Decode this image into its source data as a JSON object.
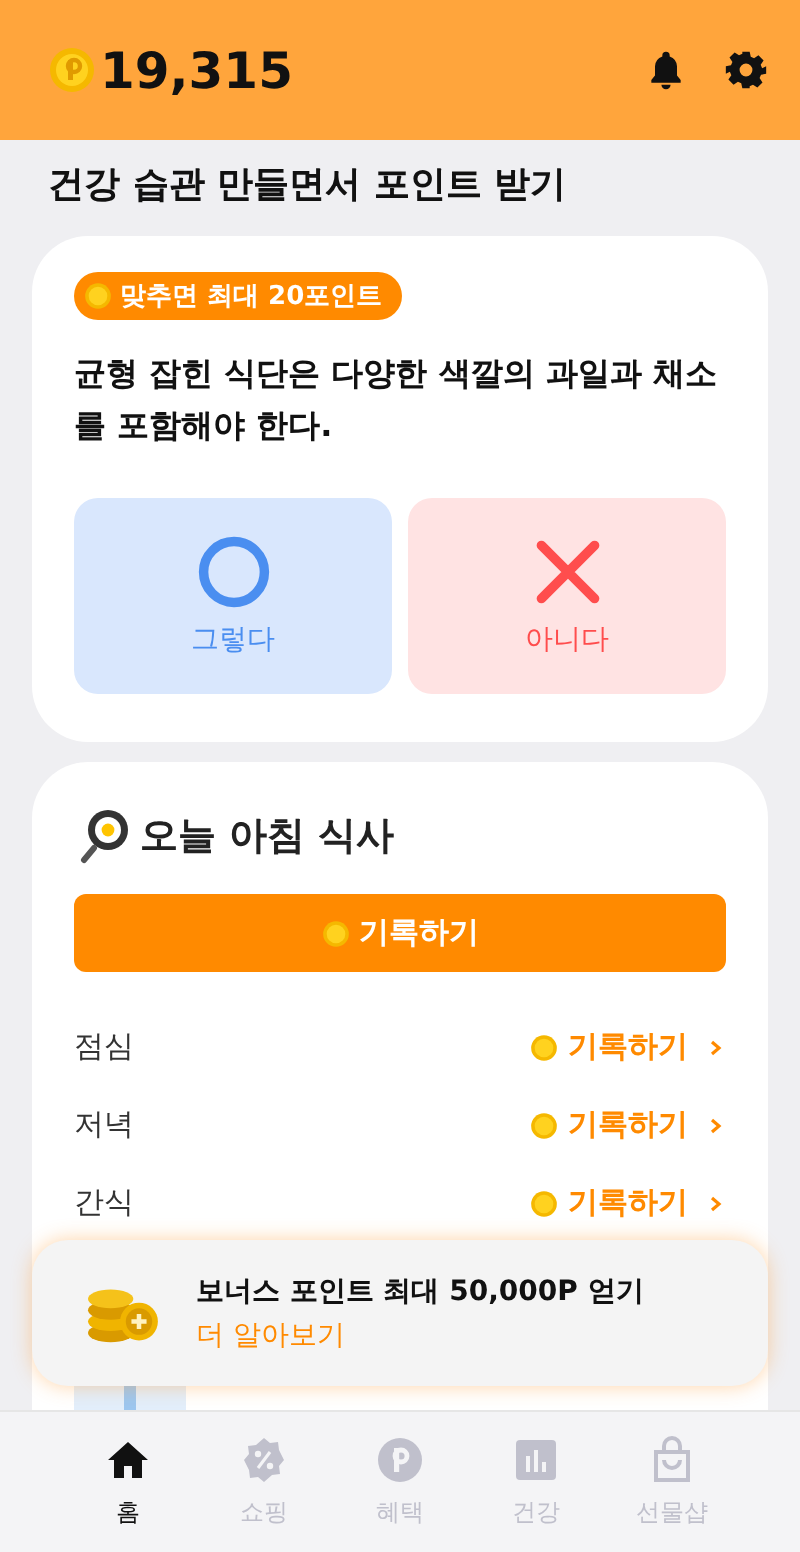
{
  "header": {
    "points": "19,315"
  },
  "subtitle": "건강 습관 만들면서 포인트 받기",
  "quiz": {
    "badge": "맞추면 최대 20포인트",
    "question": "균형 잡힌 식단은 다양한 색깔의 과일과 채소를 포함해야 한다.",
    "answers": [
      {
        "kind": "circle",
        "label": "그렇다"
      },
      {
        "kind": "cross",
        "label": "아니다"
      }
    ]
  },
  "meals": {
    "title": "오늘 아침 식사",
    "button": "기록하기",
    "rows": [
      {
        "label": "점심",
        "action": "기록하기"
      },
      {
        "label": "저녁",
        "action": "기록하기"
      },
      {
        "label": "간식",
        "action": "기록하기"
      }
    ]
  },
  "banner": {
    "title": "보너스 포인트 최대 50,000P 얻기",
    "link": "더 알아보기"
  },
  "tabs": [
    {
      "kind": "home",
      "label": "홈",
      "selected": true
    },
    {
      "kind": "shopping",
      "label": "쇼핑",
      "selected": false
    },
    {
      "kind": "points",
      "label": "혜택",
      "selected": false
    },
    {
      "kind": "chart",
      "label": "건강",
      "selected": false
    },
    {
      "kind": "bag",
      "label": "선물샵",
      "selected": false
    }
  ]
}
